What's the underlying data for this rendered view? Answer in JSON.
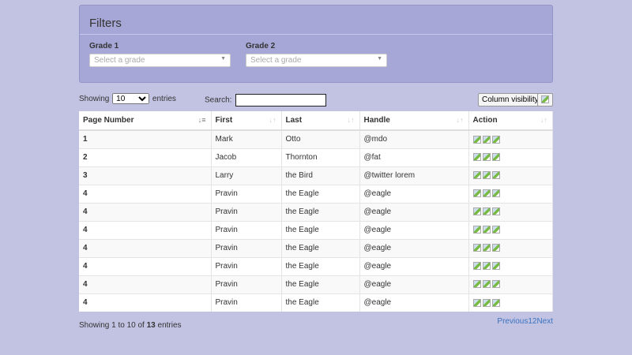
{
  "filters": {
    "title": "Filters",
    "grade1_label": "Grade 1",
    "grade2_label": "Grade 2",
    "placeholder": "Select a grade"
  },
  "controls": {
    "showing_prefix": "Showing",
    "page_length": "10",
    "entries_suffix": "entries",
    "search_label": "Search:",
    "search_value": "",
    "column_visibility": "Column visibility"
  },
  "table": {
    "headers": [
      "Page Number",
      "First",
      "Last",
      "Handle",
      "Action"
    ],
    "rows": [
      [
        "1",
        "Mark",
        "Otto",
        "@mdo"
      ],
      [
        "2",
        "Jacob",
        "Thornton",
        "@fat"
      ],
      [
        "3",
        "Larry",
        "the Bird",
        "@twitter lorem"
      ],
      [
        "4",
        "Pravin",
        "the Eagle",
        "@eagle"
      ],
      [
        "4",
        "Pravin",
        "the Eagle",
        "@eagle"
      ],
      [
        "4",
        "Pravin",
        "the Eagle",
        "@eagle"
      ],
      [
        "4",
        "Pravin",
        "the Eagle",
        "@eagle"
      ],
      [
        "4",
        "Pravin",
        "the Eagle",
        "@eagle"
      ],
      [
        "4",
        "Pravin",
        "the Eagle",
        "@eagle"
      ],
      [
        "4",
        "Pravin",
        "the Eagle",
        "@eagle"
      ]
    ]
  },
  "footer": {
    "info_prefix": "Showing 1 to 10 of ",
    "total": "13",
    "info_suffix": " entries",
    "pagination": [
      "Previous",
      "1",
      "2",
      "Next"
    ]
  }
}
